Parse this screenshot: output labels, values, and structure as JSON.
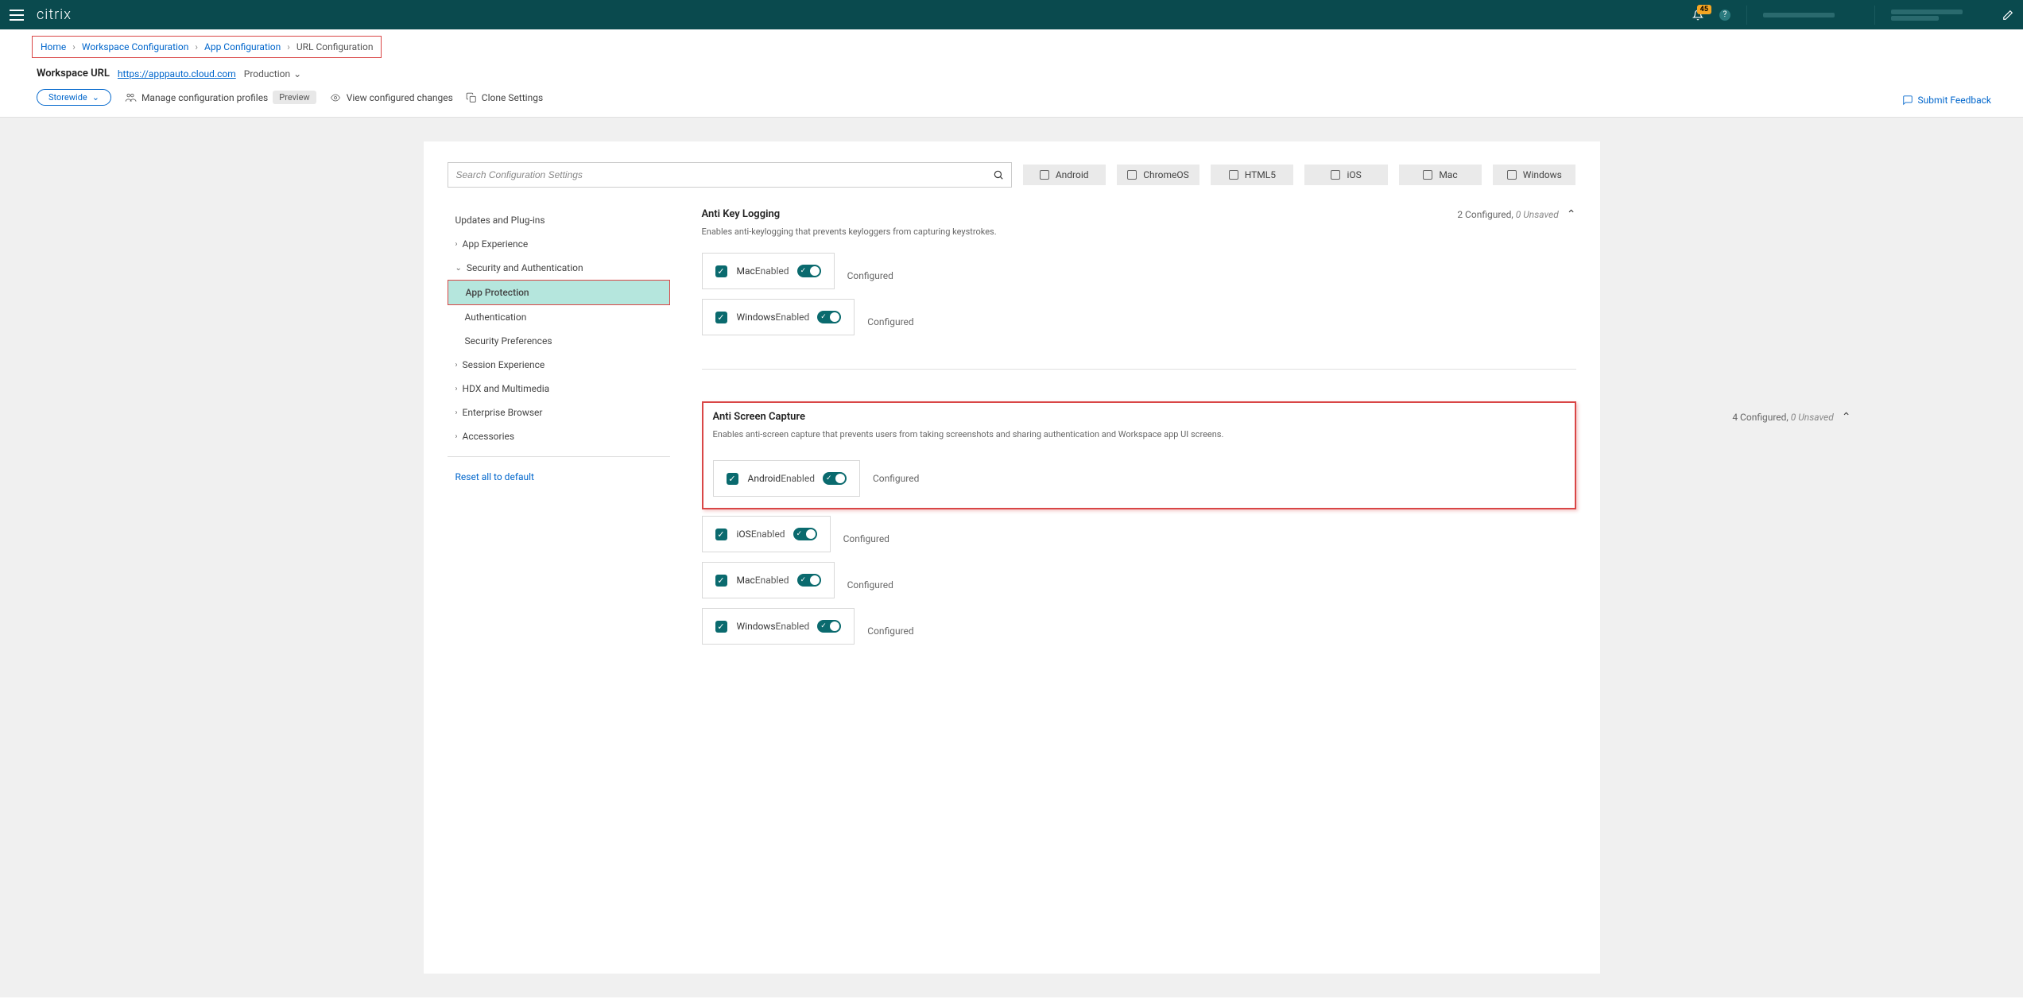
{
  "header": {
    "logo": "citrix",
    "badge": "45"
  },
  "breadcrumb": {
    "home": "Home",
    "workspace_config": "Workspace Configuration",
    "app_config": "App Configuration",
    "url_config": "URL Configuration"
  },
  "workspace": {
    "label": "Workspace URL",
    "url": "https://apppauto.cloud.com",
    "env": "Production"
  },
  "toolbar": {
    "storewide": "Storewide",
    "manage_profiles": "Manage configuration profiles",
    "preview": "Preview",
    "view_changes": "View configured changes",
    "clone": "Clone Settings",
    "feedback": "Submit Feedback"
  },
  "search": {
    "placeholder": "Search Configuration Settings"
  },
  "filters": [
    "Android",
    "ChromeOS",
    "HTML5",
    "iOS",
    "Mac",
    "Windows"
  ],
  "sidebar": {
    "items": [
      {
        "label": "Updates and Plug-ins",
        "expand": false
      },
      {
        "label": "App Experience",
        "expand": true
      },
      {
        "label": "Security and Authentication",
        "expand": true,
        "open": true
      },
      {
        "label": "App Protection",
        "sub": true,
        "selected": true
      },
      {
        "label": "Authentication",
        "sub": true
      },
      {
        "label": "Security Preferences",
        "sub": true
      },
      {
        "label": "Session Experience",
        "expand": true
      },
      {
        "label": "HDX and Multimedia",
        "expand": true
      },
      {
        "label": "Enterprise Browser",
        "expand": true
      },
      {
        "label": "Accessories",
        "expand": true
      }
    ],
    "reset": "Reset all to default"
  },
  "sections": {
    "antikey": {
      "title": "Anti Key Logging",
      "desc": "Enables anti-keylogging that prevents keyloggers from capturing keystrokes.",
      "meta_configured": "2 Configured,",
      "meta_unsaved": "0 Unsaved",
      "platforms": [
        {
          "name": "Mac",
          "state": "Enabled",
          "status": "Configured"
        },
        {
          "name": "Windows",
          "state": "Enabled",
          "status": "Configured"
        }
      ]
    },
    "antiscreen": {
      "title": "Anti Screen Capture",
      "desc": "Enables anti-screen capture that prevents users from taking screenshots and sharing authentication and Workspace app UI screens.",
      "meta_configured": "4 Configured,",
      "meta_unsaved": "0 Unsaved",
      "platforms": [
        {
          "name": "Android",
          "state": "Enabled",
          "status": "Configured"
        },
        {
          "name": "iOS",
          "state": "Enabled",
          "status": "Configured"
        },
        {
          "name": "Mac",
          "state": "Enabled",
          "status": "Configured"
        },
        {
          "name": "Windows",
          "state": "Enabled",
          "status": "Configured"
        }
      ]
    }
  }
}
